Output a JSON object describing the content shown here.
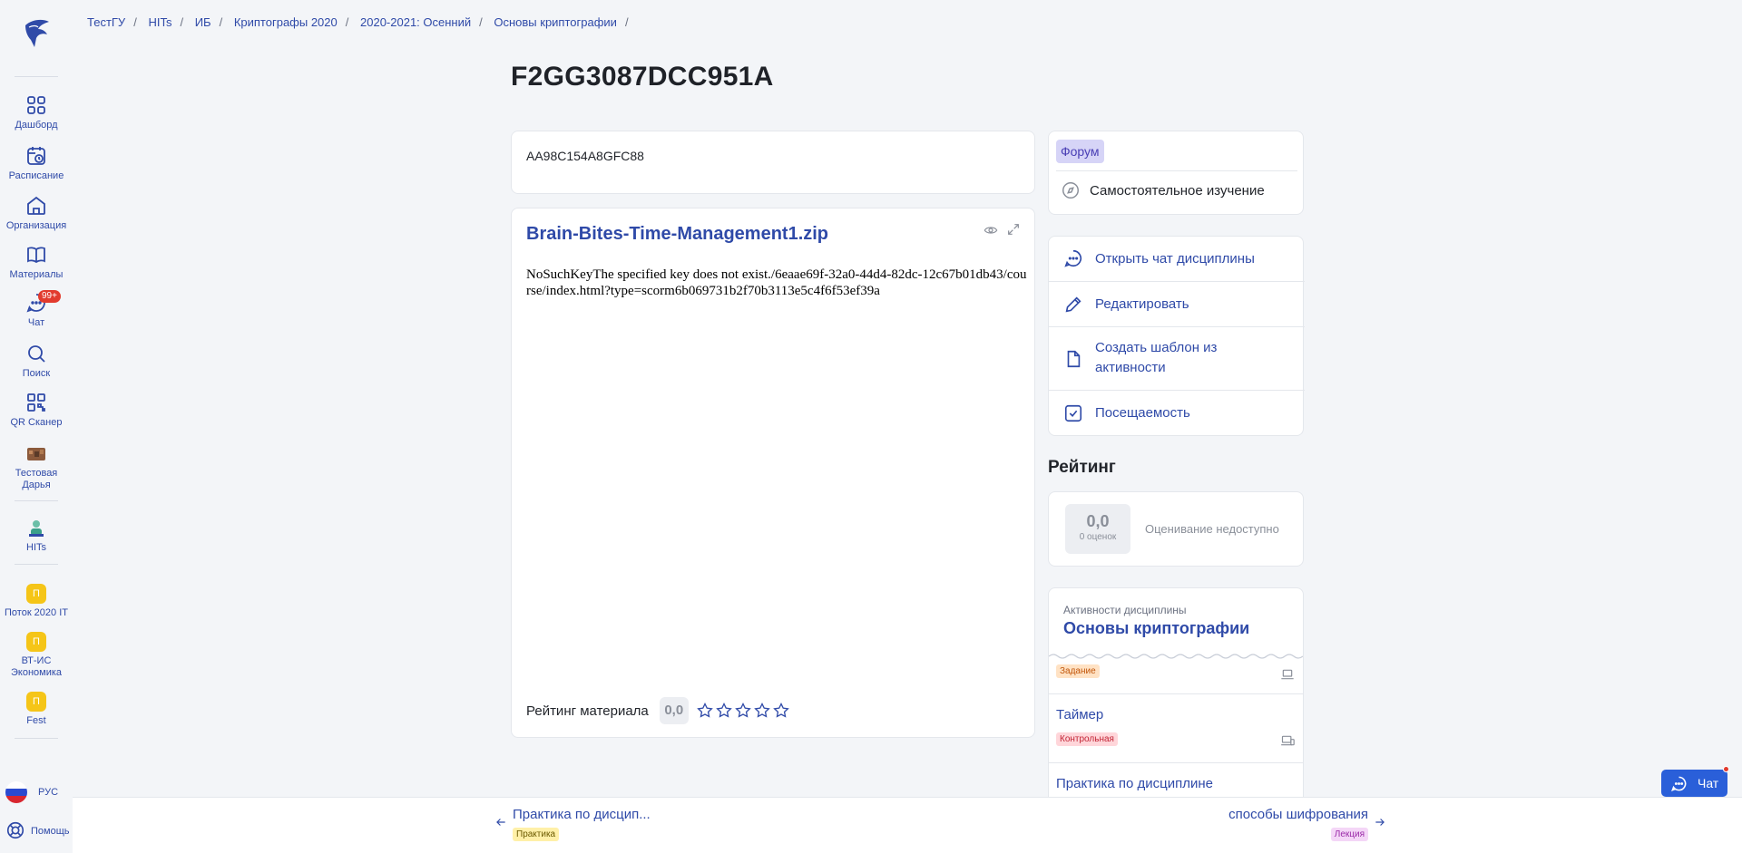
{
  "sidebar": {
    "items": [
      {
        "label": "Дашборд",
        "icon": "grid-icon"
      },
      {
        "label": "Расписание",
        "icon": "calendar-icon"
      },
      {
        "label": "Организация",
        "icon": "home-icon"
      },
      {
        "label": "Материалы",
        "icon": "book-icon"
      },
      {
        "label": "Чат",
        "icon": "chat-icon",
        "badge": "99+"
      },
      {
        "label": "Поиск",
        "icon": "search-icon"
      },
      {
        "label": "QR Сканер",
        "icon": "qr-icon"
      },
      {
        "label": "Тестовая Дарья",
        "icon": "avatar"
      },
      {
        "label": "HITs",
        "icon": "org-avatar"
      },
      {
        "label": "Поток 2020 IT",
        "letter": "П"
      },
      {
        "label": "ВТ-ИС Экономика",
        "letter": "П"
      },
      {
        "label": "Fest",
        "letter": "П"
      }
    ],
    "language": "РУС",
    "help": "Помощь"
  },
  "breadcrumb": [
    "ТестГУ",
    "HITs",
    "ИБ",
    "Криптографы 2020",
    "2020-2021: Осенний",
    "Основы криптографии"
  ],
  "title": "F2GG3087DCC951A",
  "description": "AA98C154A8GFC88",
  "file": {
    "name": "Brain-Bites-Time-Management1.zip",
    "error": "NoSuchKeyThe specified key does not exist./6eaae69f-32a0-44d4-82dc-12c67b01db43/course/index.html?type=scorm6b069731b2f70b3113e5c4f6f53ef39a",
    "rating_label": "Рейтинг материала",
    "rating_value": "0,0",
    "stars": 0
  },
  "forum": {
    "tag": "Форум",
    "mode": "Самостоятельное изучение"
  },
  "actions": [
    {
      "label": "Открыть чат дисциплины",
      "icon": "chat-bubble-icon"
    },
    {
      "label": "Редактировать",
      "icon": "pencil-icon"
    },
    {
      "label": "Создать шаблон из активности",
      "icon": "document-icon"
    },
    {
      "label": "Посещаемость",
      "icon": "checkbox-icon"
    }
  ],
  "rating": {
    "heading": "Рейтинг",
    "value": "0,0",
    "count": "0 оценок",
    "note": "Оценивание недоступно"
  },
  "activities": {
    "subtitle": "Активности дисциплины",
    "title": "Основы криптографии",
    "items": [
      {
        "name": "",
        "tag": "Задание"
      },
      {
        "name": "Таймер",
        "tag": "Контрольная"
      },
      {
        "name": "Практика по дисциплине",
        "tag": ""
      }
    ]
  },
  "nav": {
    "prev": {
      "label": "Практика по дисцип...",
      "tag": "Практика"
    },
    "next": {
      "label": "способы шифрования",
      "tag": "Лекция"
    }
  },
  "chat_button": "Чат",
  "colors": {
    "accent": "#2f4aa8",
    "background": "#f3f5f8",
    "chat": "#2a5fd9",
    "badge": "#e23b2e"
  }
}
